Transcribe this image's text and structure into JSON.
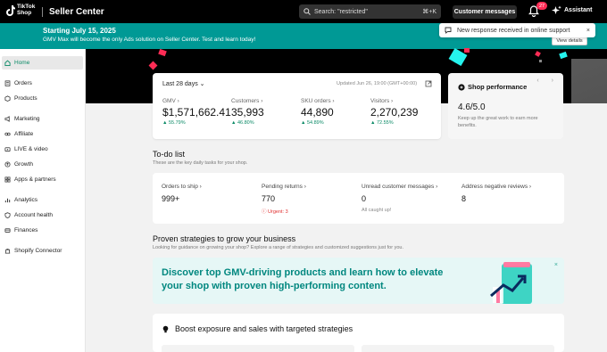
{
  "topbar": {
    "logo_text": "TikTok Shop",
    "app_title": "Seller Center",
    "search_text": "Search: \"restricted\"",
    "search_shortcut": "⌘+K",
    "customer_messages": "Customer messages",
    "notification_count": "27",
    "assistant": "Assistant"
  },
  "banner": {
    "title": "Starting July 15, 2025",
    "text": "GMV Max will become the only Ads solution on Seller Center. Test and learn today!",
    "view_details": "View details"
  },
  "toast": {
    "text": "New response received in online support",
    "close": "×"
  },
  "sidebar": {
    "items": [
      {
        "label": "Home",
        "icon": "home-icon"
      },
      {
        "label": "Orders",
        "icon": "orders-icon"
      },
      {
        "label": "Products",
        "icon": "products-icon"
      },
      {
        "label": "Marketing",
        "icon": "marketing-icon"
      },
      {
        "label": "Affiliate",
        "icon": "affiliate-icon"
      },
      {
        "label": "LIVE & video",
        "icon": "live-icon"
      },
      {
        "label": "Growth",
        "icon": "growth-icon"
      },
      {
        "label": "Apps & partners",
        "icon": "apps-icon"
      },
      {
        "label": "Analytics",
        "icon": "analytics-icon"
      },
      {
        "label": "Account health",
        "icon": "shield-icon"
      },
      {
        "label": "Finances",
        "icon": "finances-icon"
      },
      {
        "label": "Shopify Connector",
        "icon": "connector-icon"
      }
    ]
  },
  "stats": {
    "period": "Last 28 days",
    "updated": "Updated Jun 26, 19:00 (GMT+00:00)",
    "items": [
      {
        "label": "GMV",
        "value": "$1,571,662.41",
        "change": "▲ 55.79%"
      },
      {
        "label": "Customers",
        "value": "35,993",
        "change": "▲ 46.80%"
      },
      {
        "label": "SKU orders",
        "value": "44,890",
        "change": "▲ 54.89%"
      },
      {
        "label": "Visitors",
        "value": "2,270,239",
        "change": "▲ 72.55%"
      }
    ]
  },
  "performance": {
    "title": "Shop performance",
    "score": "4.6/5.0",
    "description": "Keep up the great work to earn more benefits.",
    "arrows": "‹ ›"
  },
  "todo": {
    "title": "To-do list",
    "subtitle": "These are the key daily tasks for your shop.",
    "items": [
      {
        "label": "Orders to ship",
        "value": "999+",
        "note": ""
      },
      {
        "label": "Pending returns",
        "value": "770",
        "note": "Urgent: 3"
      },
      {
        "label": "Unread customer messages",
        "value": "0",
        "note": "All caught up!"
      },
      {
        "label": "Address negative reviews",
        "value": "8",
        "note": ""
      }
    ]
  },
  "strategies": {
    "title": "Proven strategies to grow your business",
    "subtitle": "Looking for guidance on growing your shop? Explore a range of strategies and customized suggestions just for you.",
    "promo_text": "Discover top GMV-driving products and learn how to elevate your shop with proven high-performing content.",
    "close": "×"
  },
  "boost": {
    "title": "Boost exposure and sales with targeted strategies"
  },
  "colors": {
    "brand_teal": "#009995",
    "promo_text": "#00877f",
    "positive": "#0a8a66",
    "urgent": "#e02f2f",
    "badge": "#fe2c55"
  }
}
